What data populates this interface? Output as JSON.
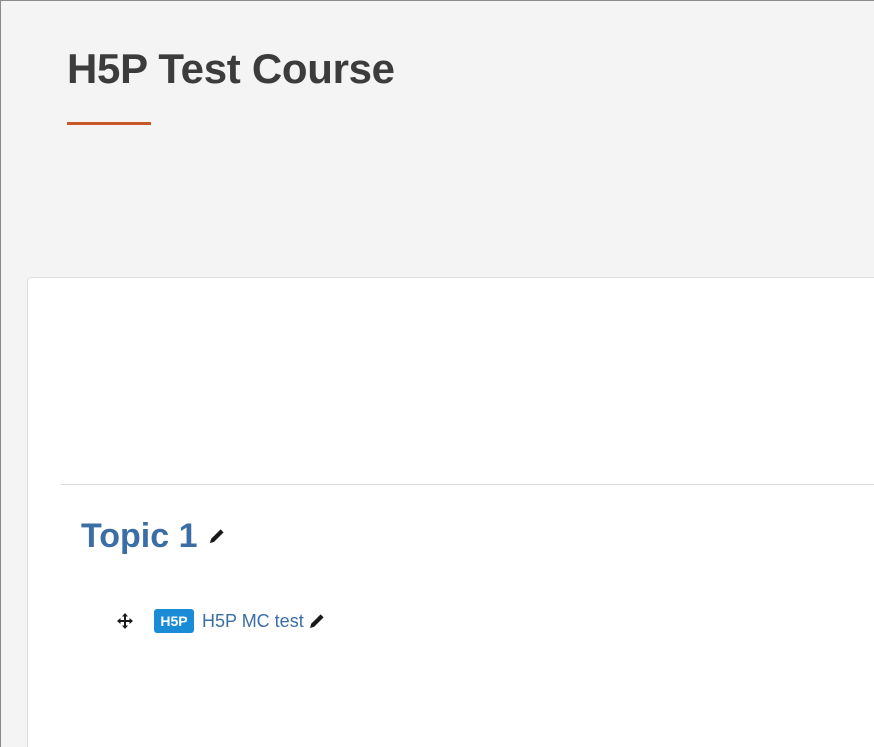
{
  "page": {
    "title": "H5P Test Course"
  },
  "section": {
    "title": "Topic 1",
    "edit_icon": "pencil-icon"
  },
  "activity": {
    "move_icon": "move-arrows-icon",
    "type_icon": "h5p-icon",
    "type_icon_text": "H5P",
    "name": "H5P MC test",
    "edit_icon": "pencil-icon"
  },
  "colors": {
    "accent_underline": "#c8582a",
    "link": "#3a6ea5",
    "h5p_badge": "#1a8bd6",
    "title_text": "#3c3c3c",
    "background": "#f4f4f4"
  }
}
